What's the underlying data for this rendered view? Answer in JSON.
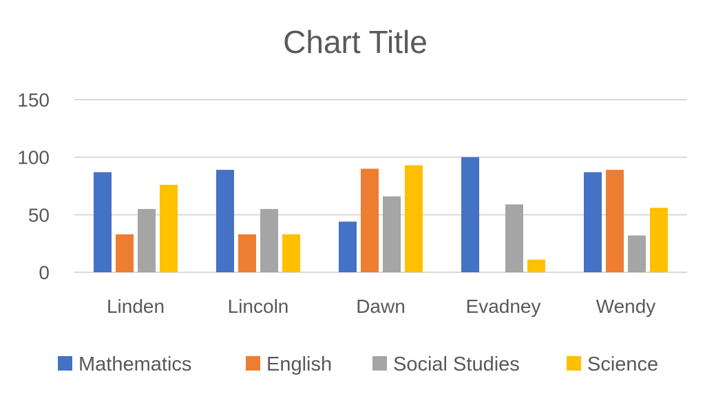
{
  "chart_data": {
    "type": "bar",
    "title": "Chart Title",
    "xlabel": "",
    "ylabel": "",
    "ylim": [
      0,
      150
    ],
    "yticks": [
      0,
      50,
      100,
      150
    ],
    "grid": true,
    "legend_position": "bottom",
    "categories": [
      "Linden",
      "Lincoln",
      "Dawn",
      "Evadney",
      "Wendy"
    ],
    "series": [
      {
        "name": "Mathematics",
        "color": "#4472c4",
        "values": [
          87,
          89,
          44,
          100,
          87
        ]
      },
      {
        "name": "English",
        "color": "#ed7d31",
        "values": [
          33,
          33,
          90,
          0,
          89
        ]
      },
      {
        "name": "Social Studies",
        "color": "#a5a5a5",
        "values": [
          55,
          55,
          66,
          59,
          32
        ]
      },
      {
        "name": "Science",
        "color": "#ffc000",
        "values": [
          76,
          33,
          93,
          11,
          56
        ]
      }
    ]
  }
}
